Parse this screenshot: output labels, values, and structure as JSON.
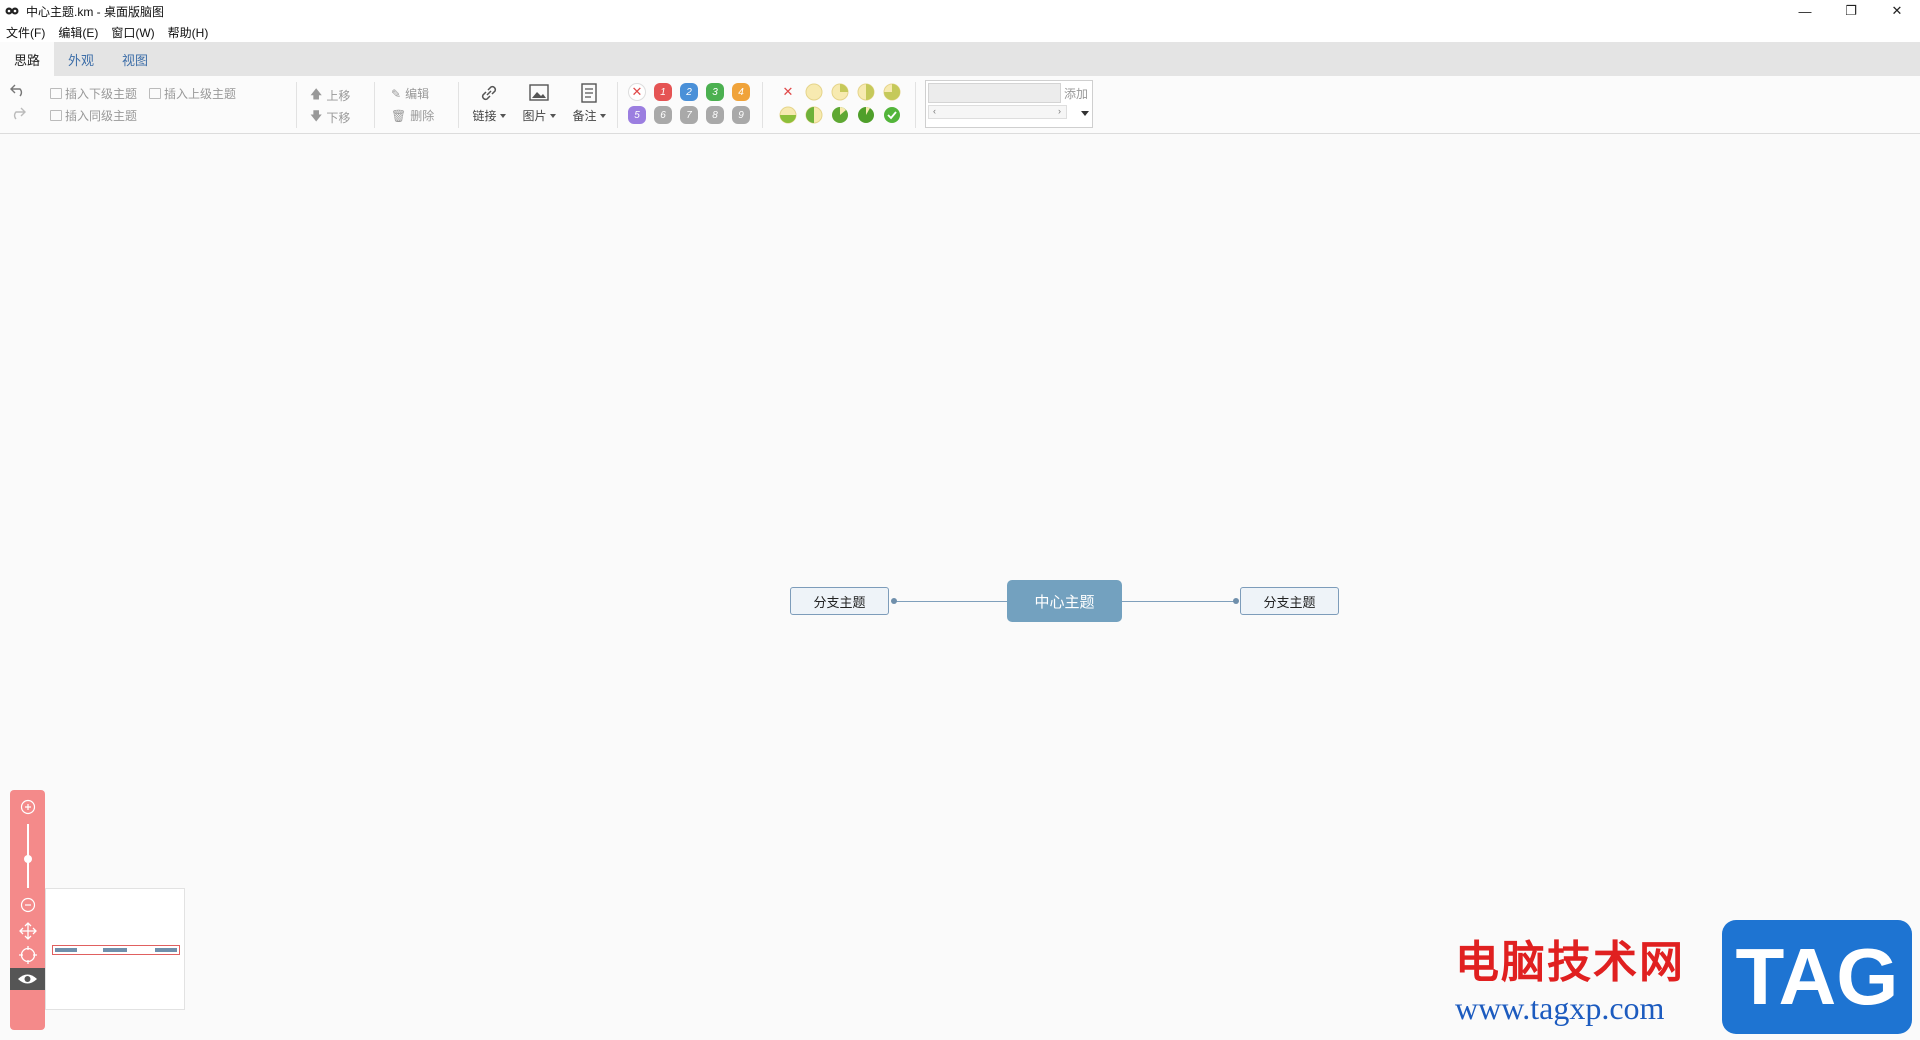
{
  "window": {
    "title": "中心主题.km - 桌面版脑图",
    "controls": {
      "minimize": "—",
      "restore": "❐",
      "close": "✕"
    }
  },
  "menubar": [
    "文件(F)",
    "编辑(E)",
    "窗口(W)",
    "帮助(H)"
  ],
  "tabs": [
    "思路",
    "外观",
    "视图"
  ],
  "toolbar": {
    "insert_child": "插入下级主题",
    "insert_parent": "插入上级主题",
    "insert_sibling": "插入同级主题",
    "move_up": "上移",
    "move_down": "下移",
    "edit": "编辑",
    "delete": "删除",
    "link": "链接",
    "image": "图片",
    "note": "备注",
    "priorities": [
      "1",
      "2",
      "3",
      "4",
      "5",
      "6",
      "7",
      "8",
      "9"
    ],
    "resource_add": "添加"
  },
  "mindmap": {
    "root": "中心主题",
    "left_branch": "分支主题",
    "right_branch": "分支主题"
  },
  "watermark": {
    "cn": "电脑技术网",
    "url": "www.tagxp.com",
    "tag": "TAG"
  },
  "colors": {
    "root_fill": "#73a1bf",
    "branch_border": "#7d9cba",
    "zoom_panel": "#f48a8a",
    "tab_text": "#3d6ea8"
  }
}
